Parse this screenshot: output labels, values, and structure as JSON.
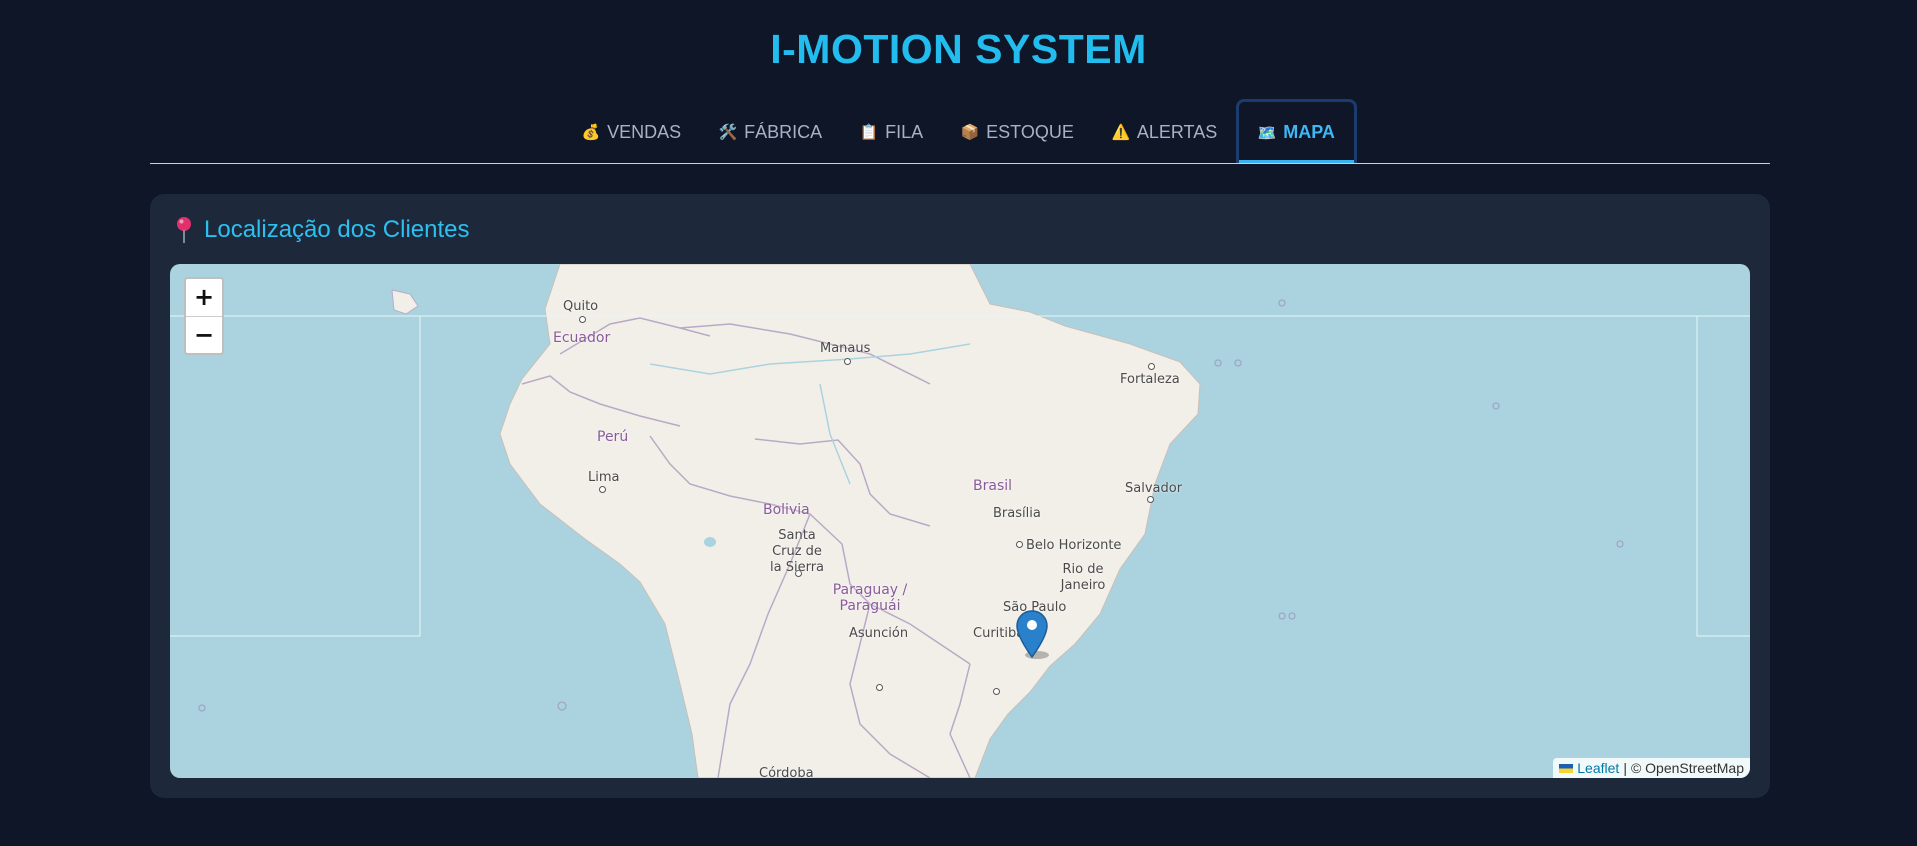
{
  "header": {
    "title": "I-MOTION SYSTEM"
  },
  "nav": {
    "tabs": [
      {
        "icon": "💰",
        "label": "VENDAS",
        "active": false
      },
      {
        "icon": "🛠️",
        "label": "FÁBRICA",
        "active": false
      },
      {
        "icon": "📋",
        "label": "FILA",
        "active": false
      },
      {
        "icon": "📦",
        "label": "ESTOQUE",
        "active": false
      },
      {
        "icon": "⚠️",
        "label": "ALERTAS",
        "active": false
      },
      {
        "icon": "🗺️",
        "label": "MAPA",
        "active": true
      }
    ]
  },
  "card": {
    "title": "Localização dos Clientes"
  },
  "map": {
    "zoom_in": "+",
    "zoom_out": "−",
    "labels": {
      "quito": "Quito",
      "ecuador": "Ecuador",
      "manaus": "Manaus",
      "fortaleza": "Fortaleza",
      "peru": "Perú",
      "lima": "Lima",
      "bolivia": "Bolivia",
      "brasil": "Brasil",
      "brasilia": "Brasília",
      "salvador": "Salvador",
      "santa_cruz": "Santa Cruz de la Sierra",
      "belo_horizonte": "Belo Horizonte",
      "rio": "Rio de Janeiro",
      "paraguay": "Paraguay / Paraguái",
      "sao_paulo": "São Paulo",
      "asuncion": "Asunción",
      "curitiba": "Curitiba",
      "cordoba": "Córdoba"
    },
    "attribution": {
      "leaflet": "Leaflet",
      "separator": "|",
      "osm": "© OpenStreetMap"
    }
  },
  "colors": {
    "accent": "#22bcee",
    "background": "#0e1628",
    "card": "#1d283b",
    "water": "#aad3df",
    "land": "#f2efe9"
  }
}
